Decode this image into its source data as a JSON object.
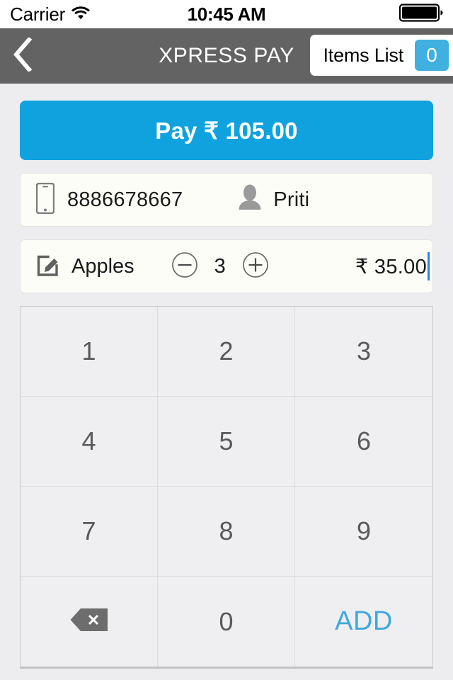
{
  "statusbar": {
    "carrier": "Carrier",
    "wifi_icon": "wifi-icon",
    "time": "10:45 AM",
    "battery_icon": "battery-full-icon"
  },
  "navbar": {
    "back_icon": "chevron-left-icon",
    "title": "XPRESS PAY",
    "items_list_label": "Items List",
    "items_list_count": "0"
  },
  "pay": {
    "label": "Pay ₹ 105.00"
  },
  "customer": {
    "phone_icon": "smartphone-icon",
    "phone": "8886678667",
    "person_icon": "person-icon",
    "name": "Priti"
  },
  "item": {
    "edit_icon": "edit-pencil-icon",
    "name": "Apples",
    "decrement_icon": "minus-circle-icon",
    "quantity": "3",
    "increment_icon": "plus-circle-icon",
    "price": "₹ 35.00"
  },
  "keypad": {
    "keys": [
      {
        "label": "1",
        "name": "key-1",
        "kind": "digit"
      },
      {
        "label": "2",
        "name": "key-2",
        "kind": "digit"
      },
      {
        "label": "3",
        "name": "key-3",
        "kind": "digit"
      },
      {
        "label": "4",
        "name": "key-4",
        "kind": "digit"
      },
      {
        "label": "5",
        "name": "key-5",
        "kind": "digit"
      },
      {
        "label": "6",
        "name": "key-6",
        "kind": "digit"
      },
      {
        "label": "7",
        "name": "key-7",
        "kind": "digit"
      },
      {
        "label": "8",
        "name": "key-8",
        "kind": "digit"
      },
      {
        "label": "9",
        "name": "key-9",
        "kind": "digit"
      },
      {
        "label": "",
        "name": "key-backspace",
        "kind": "backspace"
      },
      {
        "label": "0",
        "name": "key-0",
        "kind": "digit"
      },
      {
        "label": "ADD",
        "name": "key-add",
        "kind": "add"
      }
    ]
  },
  "colors": {
    "accent_blue": "#10a2de",
    "badge_blue": "#3fb0e0",
    "add_blue": "#3fa9dd",
    "navbar_gray": "#636363",
    "page_bg": "#ededf0",
    "card_bg": "#fdfdf8",
    "keypad_bg": "#efeff1",
    "caret_blue": "#2f7fef"
  }
}
